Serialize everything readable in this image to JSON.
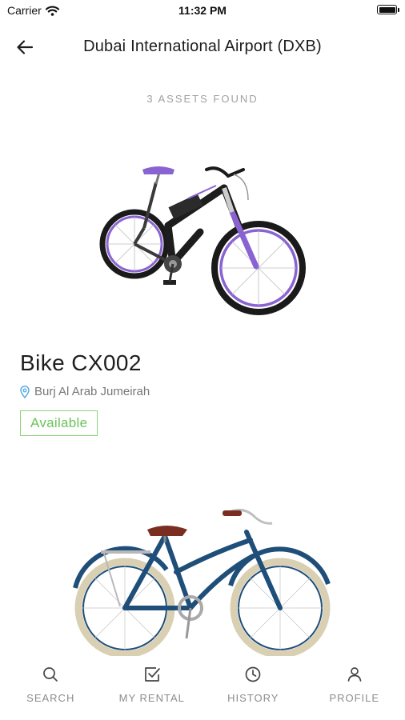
{
  "status_bar": {
    "carrier": "Carrier",
    "time": "11:32 PM"
  },
  "header": {
    "title": "Dubai International Airport (DXB)"
  },
  "results": {
    "count_label": "3 ASSETS FOUND"
  },
  "assets": [
    {
      "name": "Bike CX002",
      "location": "Burj Al Arab Jumeirah",
      "status": "Available",
      "status_color": "#6cc35a",
      "accent": "#8a63d2"
    },
    {
      "accent": "#1f4e79"
    }
  ],
  "bottom_nav": [
    {
      "label": "SEARCH",
      "icon": "search-icon"
    },
    {
      "label": "MY RENTAL",
      "icon": "checkbox-icon"
    },
    {
      "label": "HISTORY",
      "icon": "clock-icon"
    },
    {
      "label": "PROFILE",
      "icon": "person-icon"
    }
  ]
}
